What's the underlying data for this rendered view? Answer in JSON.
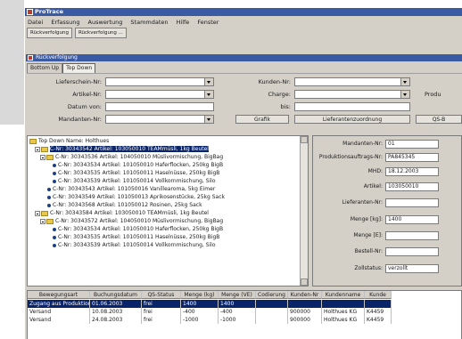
{
  "window": {
    "title": "ProTrace"
  },
  "menu": [
    "Datei",
    "Erfassung",
    "Auswertung",
    "Stammdaten",
    "Hilfe",
    "Fenster"
  ],
  "toolbar": {
    "items": [
      "Rückverfolgung",
      "Rückverfolgung ..."
    ]
  },
  "subwindow": {
    "title": "Rückverfolgung"
  },
  "tabs": [
    "Bottom Up",
    "Top Down"
  ],
  "filters": {
    "lieferschein": "Lieferschein-Nr:",
    "artikel": "Artikel-Nr:",
    "datum_von": "Datum von:",
    "mandanten": "Mandanten-Nr:",
    "kunden": "Kunden-Nr:",
    "charge": "Charge:",
    "bis": "bis:",
    "produ": "Produ",
    "grafik_btn": "Grafik",
    "lieferanten_btn": "Lieferantenzuordnung",
    "qs_btn": "QS-B"
  },
  "tree": {
    "lines": [
      "Top Down Name: Holthues",
      "C-Nr: 30343542 Artikel: 103050010 TEAMmüsli, 1kg Beutel",
      "C-Nr: 30343536 Artikel: 104050010 Müslivormischung, BigBag",
      "C-Nr: 30343534 Artikel: 101050010 Haferflocken, 250kg BigB",
      "C-Nr: 30343535 Artikel: 101050011 Haselnüsse, 250kg BigB",
      "C-Nr: 30343539 Artikel: 101050014 Vollkornmischung, Silo",
      "C-Nr: 30343543 Artikel: 101050016 Vanillearoma, 5kg Eimer",
      "C-Nr: 30343549 Artikel: 101050013 Aprikosenstücke, 25kg Sack",
      "C-Nr: 30343568 Artikel: 101050012 Rosinen, 25kg Sack",
      "C-Nr: 30343584 Artikel: 103050010 TEAMmüsli, 1kg Beutel",
      "C-Nr: 30343572 Artikel: 104050010 Müslivormischung, BigBag",
      "C-Nr: 30343534 Artikel: 101050010 Haferflocken, 250kg BigB",
      "C-Nr: 30343535 Artikel: 101050011 Haselnüsse, 250kg BigB",
      "C-Nr: 30343539 Artikel: 101050014 Vollkornmischung, Silo"
    ]
  },
  "details": {
    "labels": [
      "Mandanten-Nr:",
      "Produktionsauftrags-Nr:",
      "MHD:",
      "Artikel:",
      "Lieferanten-Nr:",
      "Menge [kg]:",
      "Menge [E]:",
      "Bestell-Nr:",
      "Zollstatus:"
    ],
    "values": [
      "01",
      "PA845345",
      "18.12.2003",
      "103050010",
      "",
      "1400",
      "",
      "",
      "verzollt"
    ]
  },
  "table": {
    "headers": [
      "Bewegungsart",
      "Buchungsdatum",
      "QS-Status",
      "Menge (kg)",
      "Menge (VE)",
      "Codierung",
      "Kunden-Nr",
      "Kundenname",
      "Kunde"
    ],
    "rows": [
      [
        "Zugang aus Produktion",
        "01.06.2003",
        "frei",
        "1400",
        "1400",
        "",
        "",
        "",
        ""
      ],
      [
        "Versand",
        "10.08.2003",
        "frei",
        "-400",
        "-400",
        "",
        "900000",
        "Holthues KG",
        "K4459"
      ],
      [
        "Versand",
        "24.08.2003",
        "frei",
        "-1000",
        "-1000",
        "",
        "900000",
        "Holthues KG",
        "K4459"
      ]
    ]
  }
}
